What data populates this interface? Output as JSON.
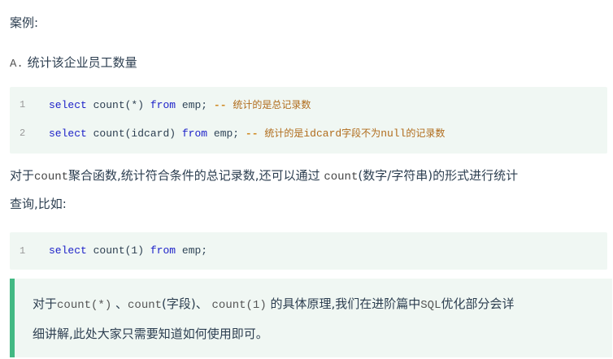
{
  "section_title": "案例:",
  "subheading": {
    "letter": "A.",
    "text": "统计该企业员工数量"
  },
  "code_block_1": {
    "lines": [
      {
        "num": "1",
        "kw1": "select",
        "fn": "count(*)",
        "kw2": "from",
        "rest": "emp;",
        "op": "--",
        "comment": "统计的是总记录数"
      },
      {
        "num": "2",
        "kw1": "select",
        "fn": "count(idcard)",
        "kw2": "from",
        "rest": "emp;",
        "op": "--",
        "comment_a": "统计的是",
        "comment_b": "idcard",
        "comment_c": "字段不为",
        "comment_d": "null",
        "comment_e": "的记录数"
      }
    ]
  },
  "paragraph": {
    "t1": "对于",
    "code1": "count",
    "t2": "聚合函数,统计符合条件的总记录数,还可以通过 ",
    "code2": "count",
    "t3": "(数字/字符串)的形式进行统计",
    "t4": "查询,比如:"
  },
  "code_block_2": {
    "lines": [
      {
        "num": "1",
        "kw1": "select",
        "fn": "count(1)",
        "kw2": "from",
        "rest": "emp;"
      }
    ]
  },
  "note": {
    "t1": "对于",
    "c1": "count(*)",
    "t2": " 、",
    "c2": "count",
    "t3": "(字段)、 ",
    "c3": "count(1)",
    "t4": " 的具体原理,我们在进阶篇中",
    "c4": "SQL",
    "t5": "优化部分会详",
    "t6": "细讲解,此处大家只需要知道如何使用即可。"
  }
}
